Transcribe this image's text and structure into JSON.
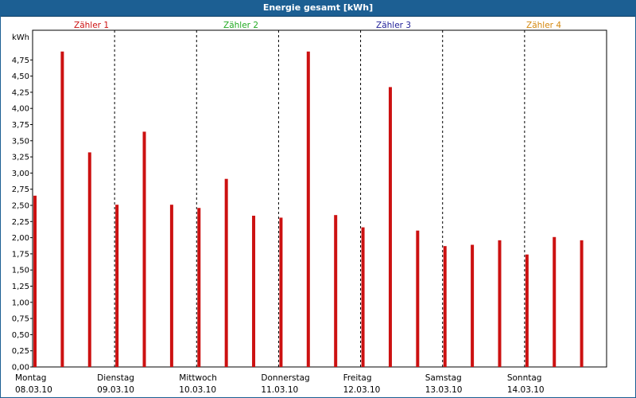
{
  "header": {
    "title": "Energie gesamt [kWh]"
  },
  "colors": {
    "title_bg": "#1c5f93",
    "bar": "#cc1111"
  },
  "chart_data": {
    "type": "bar",
    "ylabel": "kWh",
    "ylim": [
      0,
      5
    ],
    "ytick_step": 0.25,
    "ytick_labels": [
      "0,00",
      "0,25",
      "0,50",
      "0,75",
      "1,00",
      "1,25",
      "1,50",
      "1,75",
      "2,00",
      "2,25",
      "2,50",
      "2,75",
      "3,00",
      "3,25",
      "3,50",
      "3,75",
      "4,00",
      "4,25",
      "4,50",
      "4,75"
    ],
    "grid": true,
    "legend": [
      {
        "name": "Zähler 1",
        "color": "#cc1111"
      },
      {
        "name": "Zähler 2",
        "color": "#22aa22"
      },
      {
        "name": "Zähler 3",
        "color": "#222299"
      },
      {
        "name": "Zähler 4",
        "color": "#d4880f"
      }
    ],
    "days": [
      {
        "name": "Montag",
        "date": "08.03.10"
      },
      {
        "name": "Dienstag",
        "date": "09.03.10"
      },
      {
        "name": "Mittwoch",
        "date": "10.03.10"
      },
      {
        "name": "Donnerstag",
        "date": "11.03.10"
      },
      {
        "name": "Freitag",
        "date": "12.03.10"
      },
      {
        "name": "Samstag",
        "date": "13.03.10"
      },
      {
        "name": "Sonntag",
        "date": "14.03.10"
      }
    ],
    "bars_per_day": 3,
    "values": [
      2.65,
      4.88,
      3.32,
      2.51,
      3.64,
      2.51,
      2.46,
      2.91,
      2.34,
      2.31,
      4.88,
      2.35,
      2.16,
      4.33,
      2.11,
      1.87,
      1.89,
      1.96,
      1.74,
      2.01,
      1.96
    ]
  }
}
